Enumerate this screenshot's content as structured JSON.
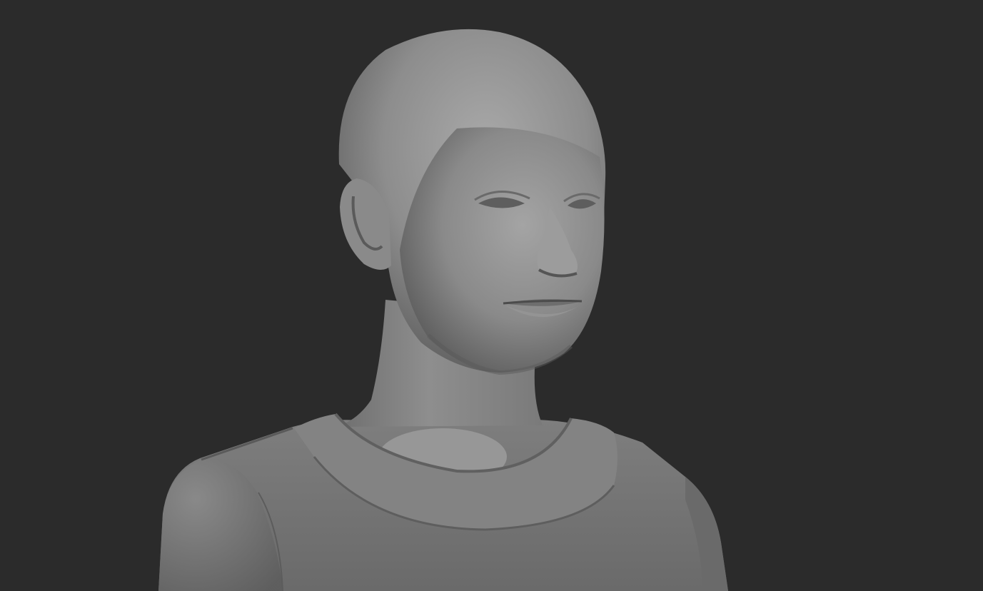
{
  "scene": {
    "background_color": "#2b2b2b",
    "subject": "sculpted-bust",
    "material_color": "#8f8f8f",
    "shadow_color": "#3a3a3a",
    "highlight_color": "#b8b8b8"
  }
}
